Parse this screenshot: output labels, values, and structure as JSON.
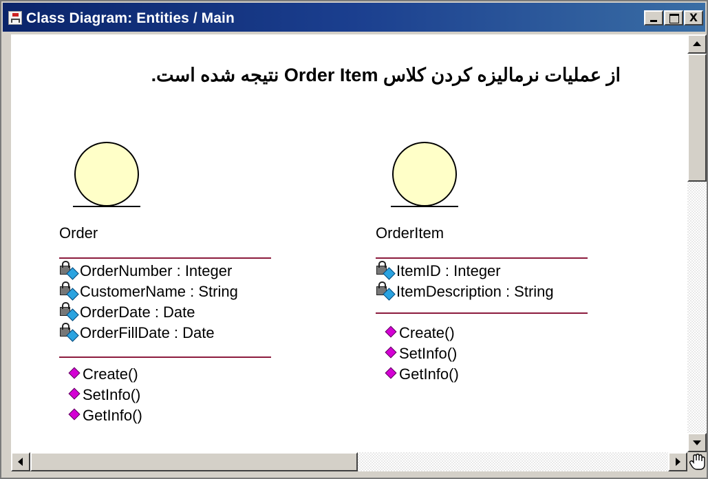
{
  "window": {
    "title": "Class Diagram: Entities / Main",
    "controls": {
      "minimize": "_",
      "maximize": "□",
      "close": "x"
    }
  },
  "diagram": {
    "heading": "از عملیات نرمالیزه کردن کلاس Order Item نتیجه شده است.",
    "classes": [
      {
        "name": "Order",
        "attributes": [
          "OrderNumber : Integer",
          "CustomerName : String",
          "OrderDate : Date",
          "OrderFillDate : Date"
        ],
        "operations": [
          "Create()",
          "SetInfo()",
          "GetInfo()"
        ]
      },
      {
        "name": "OrderItem",
        "attributes": [
          "ItemID : Integer",
          "ItemDescription : String"
        ],
        "operations": [
          "Create()",
          "SetInfo()",
          "GetInfo()"
        ]
      }
    ]
  },
  "colors": {
    "title_bar": "#0a246a",
    "entity_fill": "#ffffc8",
    "separator": "#8b1a3c",
    "operation_icon": "#d400d4",
    "attribute_icon": "#2aa3e0"
  },
  "icons": {
    "app": "class-diagram-icon",
    "attribute": "private-attribute-icon",
    "operation": "public-operation-icon",
    "cursor": "hand-cursor-icon"
  }
}
